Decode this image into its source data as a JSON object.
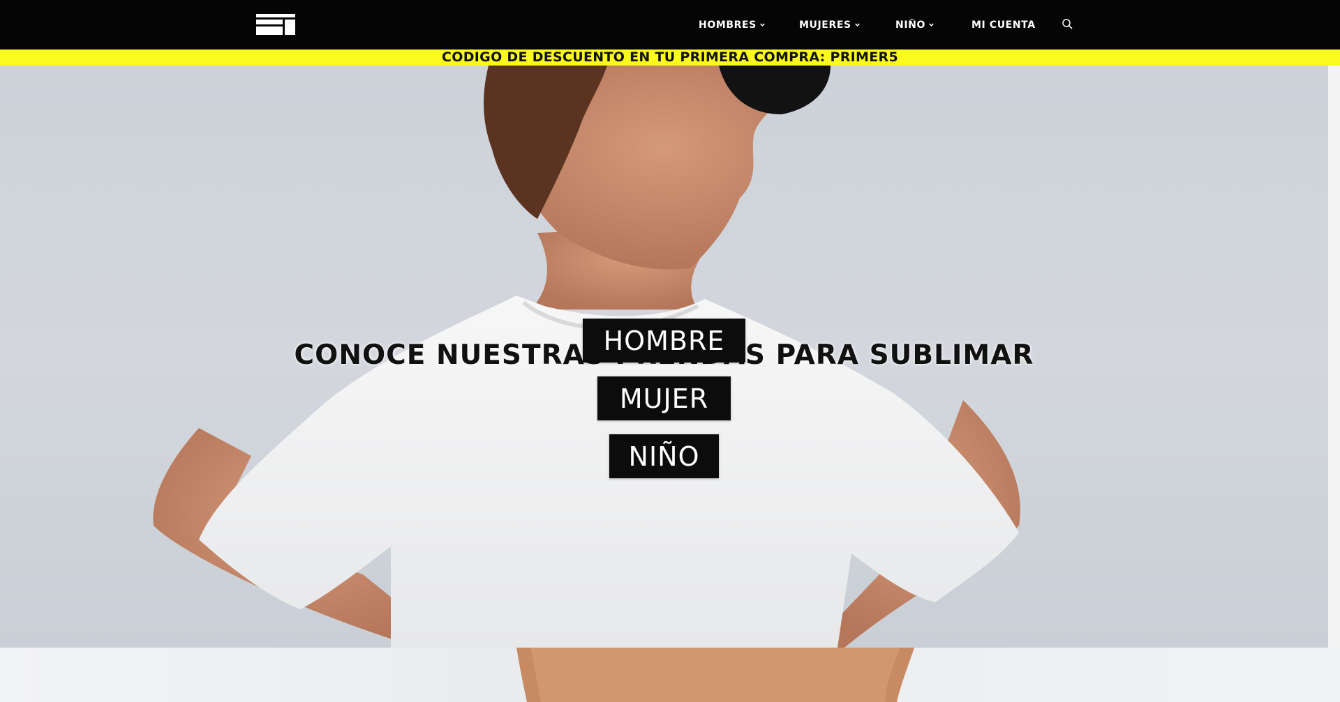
{
  "header": {
    "logo_icon": "brand-logo-icon",
    "nav": {
      "hombres": "HOMBRES",
      "mujeres": "MUJERES",
      "nino": "NIÑO",
      "cuenta": "MI CUENTA"
    },
    "search_icon": "search-icon"
  },
  "promo": {
    "text": "CODIGO DE DESCUENTO EN TU PRIMERA COMPRA: PRIMER5",
    "color": "#fbfa1e"
  },
  "hero": {
    "title": "CONOCE NUESTRAS PRENDAS PARA SUBLIMAR",
    "buttons": {
      "hombre": "HOMBRE",
      "mujer": "MUJER",
      "nino": "NIÑO"
    }
  },
  "colors": {
    "header_bg": "#050505",
    "button_bg": "#0c0c0c",
    "button_text": "#ffffff"
  }
}
